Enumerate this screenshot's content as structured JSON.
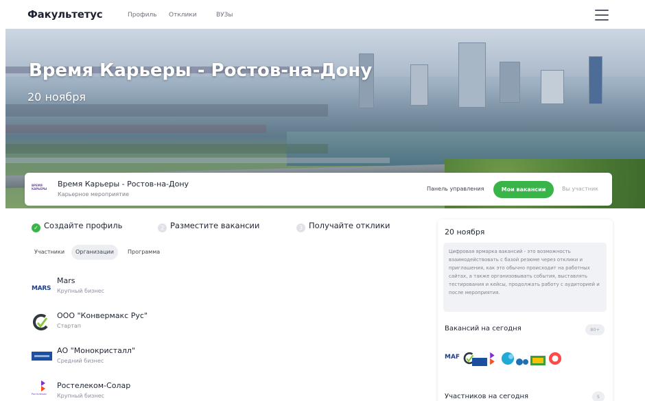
{
  "brand": {
    "name": "Факультетус"
  },
  "nav": {
    "items": [
      "Профиль",
      "Отклики",
      "ВУЗы"
    ]
  },
  "hero": {
    "title": "Время Карьеры - Ростов-на-Дону",
    "date": "20 ноября"
  },
  "event": {
    "logo_text": "ВРЕМЯ КАРЬЕРЫ",
    "title": "Время Карьеры - Ростов-на-Дону",
    "subtitle": "Карьерное мероприятие",
    "panel_label": "Панель управления",
    "vacancies_button": "Мои вакансии",
    "participant_label": "Вы участник"
  },
  "steps": [
    {
      "label": "Создайте профиль",
      "done": true,
      "num": ""
    },
    {
      "label": "Разместите вакансии",
      "done": false,
      "num": "2"
    },
    {
      "label": "Получайте отклики",
      "done": false,
      "num": "3"
    }
  ],
  "tabs": [
    {
      "label": "Участники",
      "active": false
    },
    {
      "label": "Организации",
      "active": true
    },
    {
      "label": "Программа",
      "active": false
    }
  ],
  "organizations": [
    {
      "name": "Mars",
      "type": "Крупный бизнес",
      "logo_text": "MARS",
      "icon": "mars-logo"
    },
    {
      "name": "ООО \"Конвермакс Рус\"",
      "type": "Стартап",
      "icon": "convermax-logo"
    },
    {
      "name": "АО \"Монокристалл\"",
      "type": "Средний бизнес",
      "icon": "monocrystal-logo"
    },
    {
      "name": "Ростелеком-Солар",
      "type": "Крупный бизнес",
      "logo_caption": "Ростелеком",
      "icon": "rostelecom-logo"
    }
  ],
  "sidebar": {
    "date": "20 ноября",
    "description": "Цифровая ярмарка вакансий - это возможность взаимодействовать с базой резюме через отклики и приглашения, как это обычно происходит на работных сайтах, а также организовывать события, выставлять тестирования и кейсы, продолжать работу с аудиторией и после мероприятия.",
    "vacancies_label": "Вакансий на сегодня",
    "vacancies_count": "80+",
    "participants_label": "Участников на сегодня",
    "participants_count": "5",
    "logos_caption": "MAF"
  },
  "colors": {
    "accent": "#38b449",
    "text": "#1d2333",
    "muted": "#8a8f9b"
  }
}
